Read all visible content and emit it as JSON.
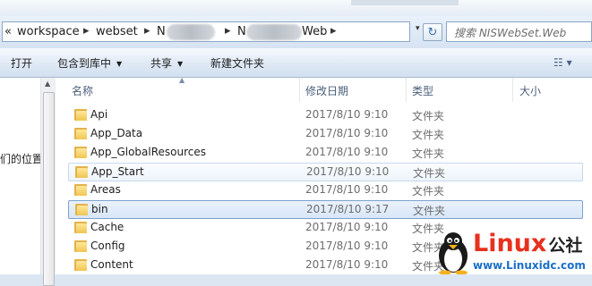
{
  "address": {
    "segments": [
      "workspace",
      "webset",
      "N",
      "N",
      "Web"
    ],
    "overflow_glyph": "«",
    "separator": "▸"
  },
  "search": {
    "placeholder": "搜索 NISWebSet.Web"
  },
  "toolbar": {
    "open_label": "打开",
    "include_label": "包含到库中",
    "share_label": "共享",
    "new_folder_label": "新建文件夹"
  },
  "navpane": {
    "partial_label": "们的位置"
  },
  "columns": {
    "name": "名称",
    "modified": "修改日期",
    "type": "类型",
    "size": "大小"
  },
  "files": [
    {
      "name": "Api",
      "modified": "2017/8/10 9:10",
      "type": "文件夹",
      "state": "normal"
    },
    {
      "name": "App_Data",
      "modified": "2017/8/10 9:10",
      "type": "文件夹",
      "state": "normal"
    },
    {
      "name": "App_GlobalResources",
      "modified": "2017/8/10 9:10",
      "type": "文件夹",
      "state": "normal"
    },
    {
      "name": "App_Start",
      "modified": "2017/8/10 9:10",
      "type": "文件夹",
      "state": "hover"
    },
    {
      "name": "Areas",
      "modified": "2017/8/10 9:10",
      "type": "文件夹",
      "state": "normal"
    },
    {
      "name": "bin",
      "modified": "2017/8/10 9:17",
      "type": "文件夹",
      "state": "selected"
    },
    {
      "name": "Cache",
      "modified": "2017/8/10 9:10",
      "type": "文件夹",
      "state": "normal"
    },
    {
      "name": "Config",
      "modified": "2017/8/10 9:10",
      "type": "文件夹",
      "state": "normal"
    },
    {
      "name": "Content",
      "modified": "2017/8/10 9:10",
      "type": "文件夹",
      "state": "normal"
    }
  ],
  "watermark": {
    "brand": "Linux",
    "brand_cn": "公社",
    "url": "www.Linuxidc.com"
  },
  "colors": {
    "selection_border": "#7da2ce",
    "folder": "#f2c552",
    "brand_red": "#e8301e",
    "link_blue": "#1b6fc9"
  }
}
